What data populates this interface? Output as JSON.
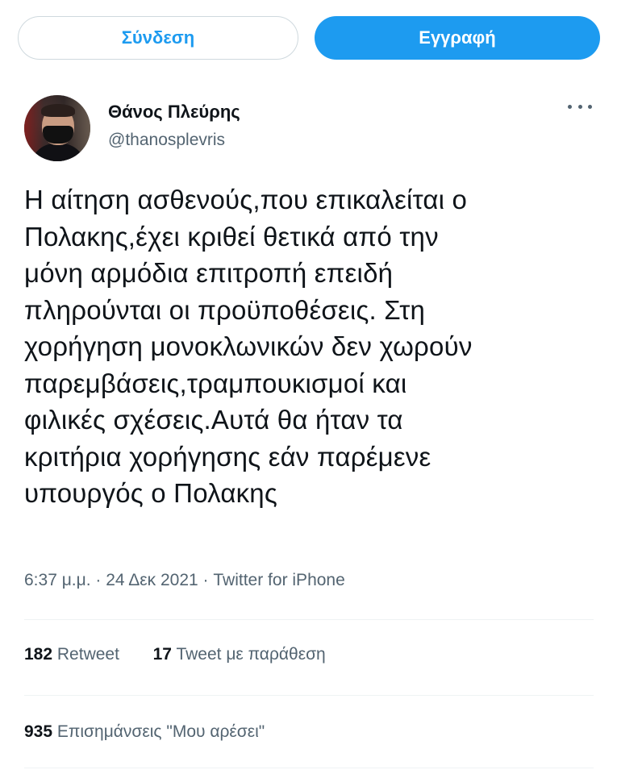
{
  "top_bar": {
    "login_label": "Σύνδεση",
    "signup_label": "Εγγραφή"
  },
  "author": {
    "name": "Θάνος Πλεύρης",
    "handle": "@thanosplevris",
    "avatar_icon": "profile-photo"
  },
  "menu_icon": "more-horizontal-icon",
  "tweet": {
    "lines": [
      "Η αίτηση ασθενούς,που επικαλείται ο",
      "Πολακης,έχει κριθεί θετικά από την",
      "μόνη αρμόδια επιτροπή επειδή",
      "πληρούνται οι προϋποθέσεις. Στη",
      "χορήγηση μονοκλωνικών δεν χωρούν",
      "παρεμβάσεις,τραμπουκισμοί και",
      "φιλικές σχέσεις.Αυτά θα ήταν τα",
      "κριτήρια χορήγησης εάν παρέμενε",
      "υπουργός ο Πολακης"
    ],
    "timestamp": "6:37 μ.μ. · 24 Δεκ 2021 · Twitter for iPhone"
  },
  "stats": {
    "retweets_count": "182",
    "retweets_label": "Retweet",
    "quotes_count": "17",
    "quotes_label": "Tweet με παράθεση",
    "likes_count": "935",
    "likes_label": "Επισημάνσεις \"Μου αρέσει\""
  },
  "colors": {
    "accent": "#1d9bf0",
    "text_primary": "#0f1419",
    "text_secondary": "#536471",
    "border": "#cfd9de",
    "divider": "#eff3f4"
  }
}
